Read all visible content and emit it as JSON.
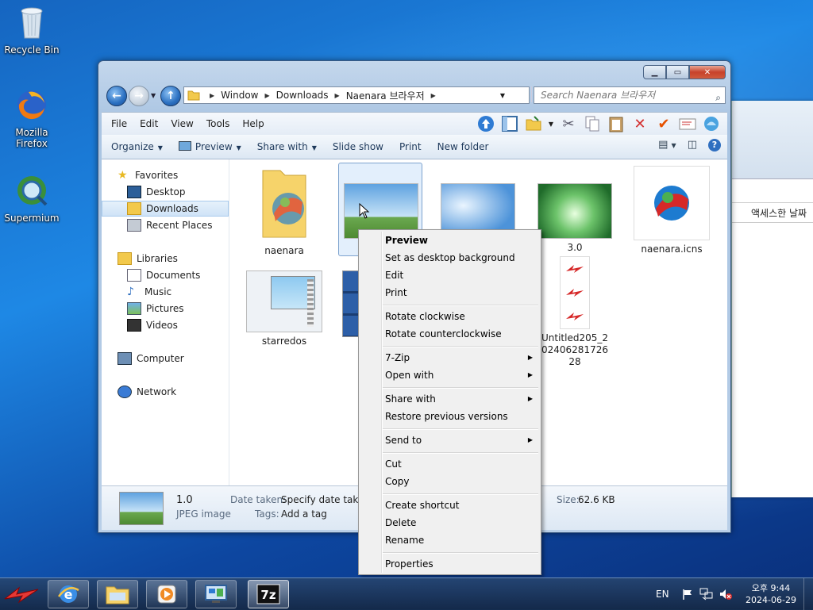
{
  "desktop": {
    "icons": [
      {
        "label": "Recycle Bin"
      },
      {
        "label": "Mozilla Firefox"
      },
      {
        "label": "Supermium"
      }
    ]
  },
  "background_window": {
    "column_header": "액세스한 날짜"
  },
  "window": {
    "breadcrumb": [
      "Window",
      "Downloads",
      "Naenara 브라우저"
    ],
    "search_placeholder": "Search Naenara 브라우저",
    "menu": [
      "File",
      "Edit",
      "View",
      "Tools",
      "Help"
    ],
    "commands": {
      "organize": "Organize",
      "preview": "Preview",
      "share_with": "Share with",
      "slide_show": "Slide show",
      "print": "Print",
      "new_folder": "New folder"
    },
    "nav_pane": {
      "favorites": "Favorites",
      "desktop": "Desktop",
      "downloads": "Downloads",
      "recent_places": "Recent Places",
      "libraries": "Libraries",
      "documents": "Documents",
      "music": "Music",
      "pictures": "Pictures",
      "videos": "Videos",
      "computer": "Computer",
      "network": "Network"
    },
    "files": [
      {
        "name": "naenara"
      },
      {
        "name": ""
      },
      {
        "name": ""
      },
      {
        "name": "3.0"
      },
      {
        "name": "naenara.icns"
      },
      {
        "name": "starredos"
      },
      {
        "name": ""
      },
      {
        "name": "Untitled205_20240628172628"
      }
    ],
    "details": {
      "name": "1.0",
      "type": "JPEG image",
      "date_label": "Date taken:",
      "date_value": "Specify date taken",
      "tags_label": "Tags:",
      "tags_value": "Add a tag",
      "size_label": "Size:",
      "size_value": "62.6 KB"
    }
  },
  "context_menu": {
    "preview": "Preview",
    "set_desktop_bg": "Set as desktop background",
    "edit": "Edit",
    "print": "Print",
    "rotate_cw": "Rotate clockwise",
    "rotate_ccw": "Rotate counterclockwise",
    "seven_zip": "7-Zip",
    "open_with": "Open with",
    "share_with": "Share with",
    "restore": "Restore previous versions",
    "send_to": "Send to",
    "cut": "Cut",
    "copy": "Copy",
    "create_shortcut": "Create shortcut",
    "delete": "Delete",
    "rename": "Rename",
    "properties": "Properties"
  },
  "taskbar": {
    "language": "EN",
    "time": "오후 9:44",
    "date": "2024-06-29"
  }
}
